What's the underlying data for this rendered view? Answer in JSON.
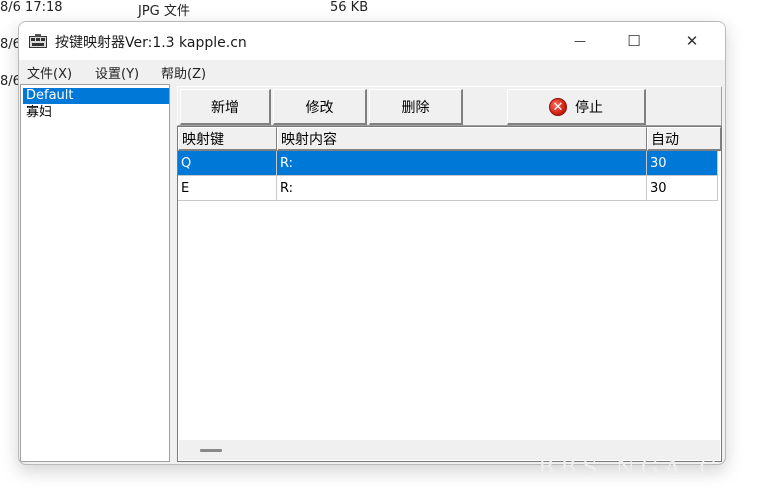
{
  "background_list": [
    {
      "date": "8/6 17:18",
      "type": "JPG 文件",
      "size": "56 KB"
    },
    {
      "date": "8/6",
      "type": "",
      "size": ""
    },
    {
      "date": "8/6",
      "type": "",
      "size": ""
    }
  ],
  "window": {
    "title": "按键映射器Ver:1.3  kapple.cn",
    "controls": {
      "minimize": "—",
      "maximize": "☐",
      "close": "✕"
    }
  },
  "menu": [
    "文件(X)",
    "设置(Y)",
    "帮助(Z)"
  ],
  "profiles": [
    {
      "label": "Default",
      "selected": true
    },
    {
      "label": "寡妇",
      "selected": false
    }
  ],
  "toolbar": {
    "add_label": "新增",
    "edit_label": "修改",
    "delete_label": "删除",
    "stop_label": "停止",
    "stop_icon_glyph": "✕"
  },
  "table": {
    "columns": [
      "映射键",
      "映射内容",
      "自动"
    ],
    "rows": [
      {
        "key": "Q",
        "content": "R:",
        "auto": "30",
        "selected": true
      },
      {
        "key": "E",
        "content": "R:",
        "auto": "30",
        "selected": false
      }
    ]
  },
  "colors": {
    "selection": "#0078d7",
    "stop_icon": "#d9261c"
  },
  "watermark": "BBS.NGA.C"
}
